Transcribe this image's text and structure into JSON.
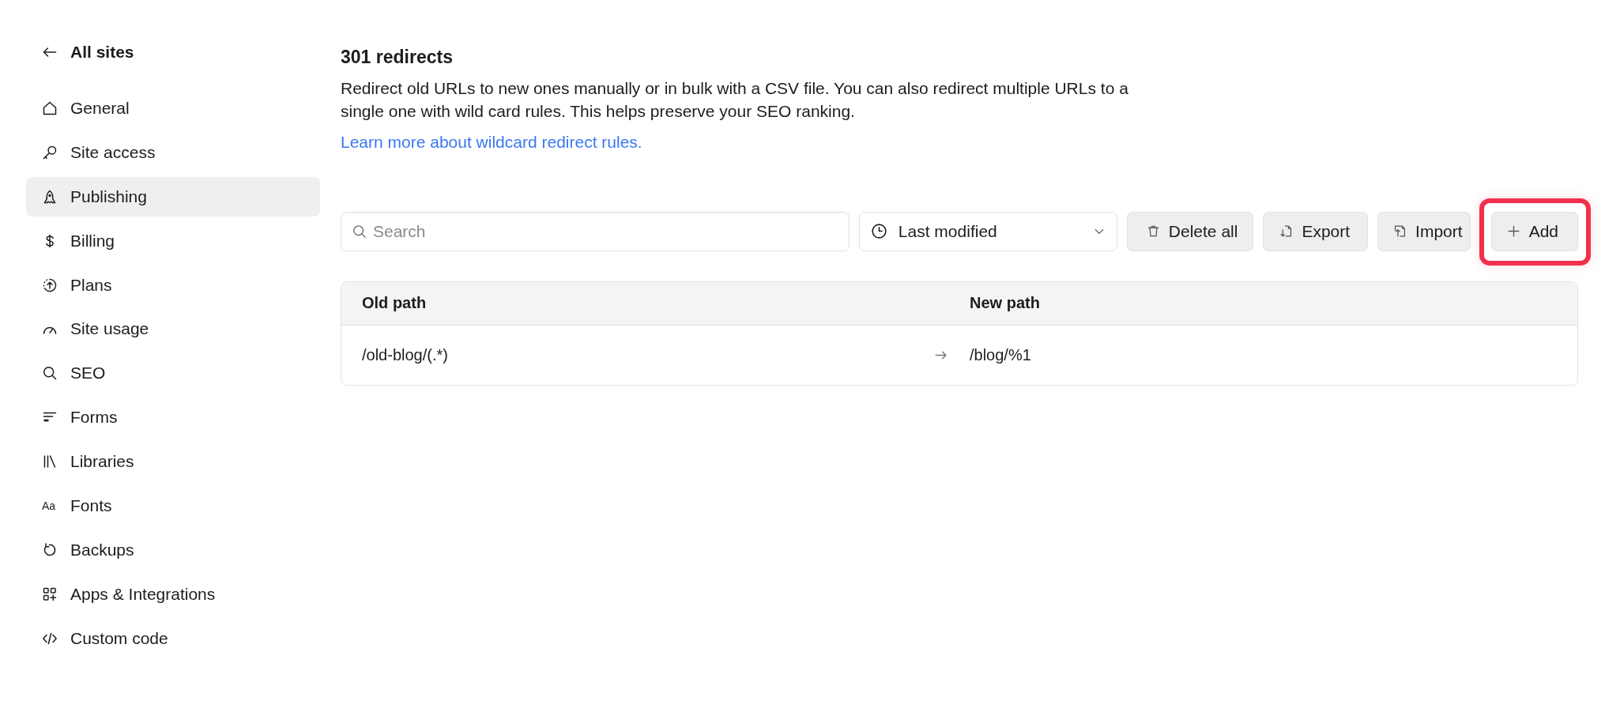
{
  "sidebar": {
    "back_link": {
      "label": "All sites"
    },
    "items": [
      {
        "label": "General",
        "selected": false
      },
      {
        "label": "Site access",
        "selected": false
      },
      {
        "label": "Publishing",
        "selected": true
      },
      {
        "label": "Billing",
        "selected": false
      },
      {
        "label": "Plans",
        "selected": false
      },
      {
        "label": "Site usage",
        "selected": false
      },
      {
        "label": "SEO",
        "selected": false
      },
      {
        "label": "Forms",
        "selected": false
      },
      {
        "label": "Libraries",
        "selected": false
      },
      {
        "label": "Fonts",
        "selected": false,
        "icon_glyph": "Aa"
      },
      {
        "label": "Backups",
        "selected": false
      },
      {
        "label": "Apps & Integrations",
        "selected": false
      },
      {
        "label": "Custom code",
        "selected": false
      }
    ]
  },
  "main": {
    "title": "301 redirects",
    "description": "Redirect old URLs to new ones manually or in bulk with a CSV file. You can also redirect multiple URLs to a single one with wild card rules. This helps preserve your SEO ranking.",
    "link": "Learn more about wildcard redirect rules.",
    "toolbar": {
      "search": {
        "placeholder": "Search"
      },
      "sort": {
        "value": "Last modified"
      },
      "buttons": [
        {
          "kind": "delete",
          "label": "Delete all",
          "highlighted": false
        },
        {
          "kind": "export",
          "label": "Export",
          "highlighted": false
        },
        {
          "kind": "import",
          "label": "Import",
          "highlighted": false
        },
        {
          "kind": "add",
          "label": "Add",
          "highlighted": true
        }
      ]
    },
    "table": {
      "columns": [
        "Old path",
        "New path"
      ],
      "rows": [
        {
          "old_path": "/old-blog/(.*)",
          "new_path": "/blog/%1"
        }
      ]
    }
  }
}
